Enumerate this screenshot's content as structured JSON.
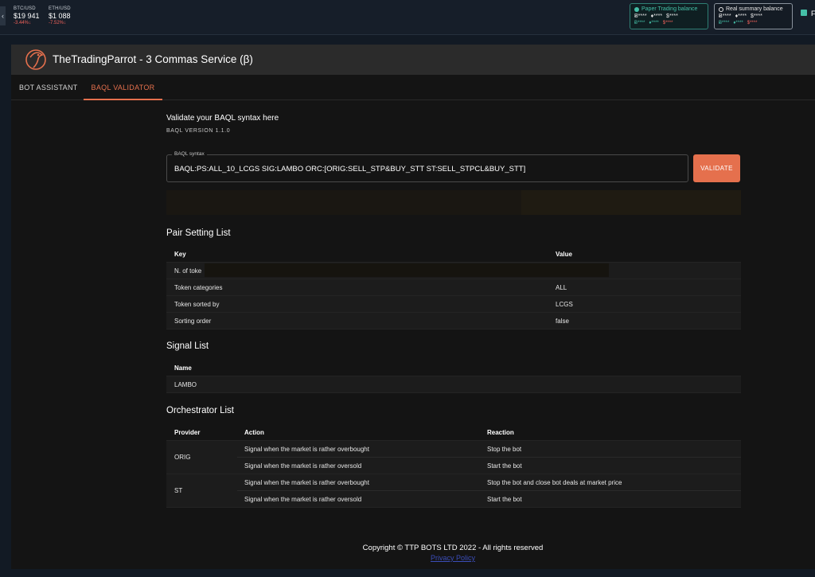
{
  "ticker": {
    "collapse_glyph": "‹",
    "items": [
      {
        "symbol": "BTC/USD",
        "price": "$19 941",
        "change": "-3.44%↓"
      },
      {
        "symbol": "ETH/USD",
        "price": "$1 088",
        "change": "-7.52%↓"
      }
    ]
  },
  "balances": {
    "paper": {
      "title": "Paper Trading balance",
      "row1": [
        "Ƀ****",
        "♦****",
        "$****"
      ],
      "row2": [
        "Ƀ****",
        "♦****",
        "$****"
      ]
    },
    "real": {
      "title": "Real summary balance",
      "row1": [
        "Ƀ****",
        "♦****",
        "$****"
      ],
      "row2": [
        "Ƀ****",
        "♦****",
        "$****"
      ]
    }
  },
  "corner_text": "F",
  "colors": {
    "accent": "#e5704d",
    "teal": "#45c0a8",
    "negative": "#f0625a"
  },
  "app": {
    "title": "TheTradingParrot - 3 Commas Service (β)",
    "logo_icon": "parrot-logo-icon"
  },
  "tabs": [
    {
      "label": "BOT ASSISTANT",
      "active": false
    },
    {
      "label": "BAQL VALIDATOR",
      "active": true
    }
  ],
  "validator": {
    "heading": "Validate your BAQL syntax here",
    "version": "BAQL VERSION 1.1.0",
    "field_legend": "BAQL syntax",
    "field_value": "BAQL:PS:ALL_10_LCGS SIG:LAMBO ORC:[ORIG:SELL_STP&BUY_STT ST:SELL_STPCL&BUY_STT]",
    "button_label": "VALIDATE"
  },
  "pair_settings": {
    "title": "Pair Setting List",
    "headers": [
      "Key",
      "Value"
    ],
    "rows": [
      {
        "key": "N. of toke",
        "value": ""
      },
      {
        "key": "Token categories",
        "value": "ALL"
      },
      {
        "key": "Token sorted by",
        "value": "LCGS"
      },
      {
        "key": "Sorting order",
        "value": "false"
      }
    ]
  },
  "signals": {
    "title": "Signal List",
    "headers": [
      "Name"
    ],
    "rows": [
      "LAMBO"
    ]
  },
  "orchestrators": {
    "title": "Orchestrator List",
    "headers": [
      "Provider",
      "Action",
      "Reaction"
    ],
    "groups": [
      {
        "provider": "ORIG",
        "rows": [
          {
            "action": "Signal when the market is rather overbought",
            "reaction": "Stop the bot"
          },
          {
            "action": "Signal when the market is rather oversold",
            "reaction": "Start the bot"
          }
        ]
      },
      {
        "provider": "ST",
        "rows": [
          {
            "action": "Signal when the market is rather overbought",
            "reaction": "Stop the bot and close bot deals at market price"
          },
          {
            "action": "Signal when the market is rather oversold",
            "reaction": "Start the bot"
          }
        ]
      }
    ]
  },
  "footer": {
    "copyright": "Copyright © TTP BOTS LTD 2022 - All rights reserved",
    "privacy": "Privacy Policy"
  }
}
